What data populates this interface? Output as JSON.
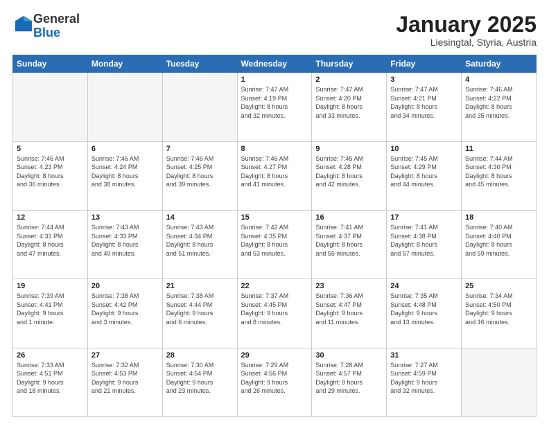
{
  "header": {
    "logo_general": "General",
    "logo_blue": "Blue",
    "month_title": "January 2025",
    "subtitle": "Liesingtal, Styria, Austria"
  },
  "weekdays": [
    "Sunday",
    "Monday",
    "Tuesday",
    "Wednesday",
    "Thursday",
    "Friday",
    "Saturday"
  ],
  "weeks": [
    [
      {
        "day": "",
        "info": ""
      },
      {
        "day": "",
        "info": ""
      },
      {
        "day": "",
        "info": ""
      },
      {
        "day": "1",
        "info": "Sunrise: 7:47 AM\nSunset: 4:19 PM\nDaylight: 8 hours\nand 32 minutes."
      },
      {
        "day": "2",
        "info": "Sunrise: 7:47 AM\nSunset: 4:20 PM\nDaylight: 8 hours\nand 33 minutes."
      },
      {
        "day": "3",
        "info": "Sunrise: 7:47 AM\nSunset: 4:21 PM\nDaylight: 8 hours\nand 34 minutes."
      },
      {
        "day": "4",
        "info": "Sunrise: 7:46 AM\nSunset: 4:22 PM\nDaylight: 8 hours\nand 35 minutes."
      }
    ],
    [
      {
        "day": "5",
        "info": "Sunrise: 7:46 AM\nSunset: 4:23 PM\nDaylight: 8 hours\nand 36 minutes."
      },
      {
        "day": "6",
        "info": "Sunrise: 7:46 AM\nSunset: 4:24 PM\nDaylight: 8 hours\nand 38 minutes."
      },
      {
        "day": "7",
        "info": "Sunrise: 7:46 AM\nSunset: 4:25 PM\nDaylight: 8 hours\nand 39 minutes."
      },
      {
        "day": "8",
        "info": "Sunrise: 7:46 AM\nSunset: 4:27 PM\nDaylight: 8 hours\nand 41 minutes."
      },
      {
        "day": "9",
        "info": "Sunrise: 7:45 AM\nSunset: 4:28 PM\nDaylight: 8 hours\nand 42 minutes."
      },
      {
        "day": "10",
        "info": "Sunrise: 7:45 AM\nSunset: 4:29 PM\nDaylight: 8 hours\nand 44 minutes."
      },
      {
        "day": "11",
        "info": "Sunrise: 7:44 AM\nSunset: 4:30 PM\nDaylight: 8 hours\nand 45 minutes."
      }
    ],
    [
      {
        "day": "12",
        "info": "Sunrise: 7:44 AM\nSunset: 4:31 PM\nDaylight: 8 hours\nand 47 minutes."
      },
      {
        "day": "13",
        "info": "Sunrise: 7:43 AM\nSunset: 4:33 PM\nDaylight: 8 hours\nand 49 minutes."
      },
      {
        "day": "14",
        "info": "Sunrise: 7:43 AM\nSunset: 4:34 PM\nDaylight: 8 hours\nand 51 minutes."
      },
      {
        "day": "15",
        "info": "Sunrise: 7:42 AM\nSunset: 4:35 PM\nDaylight: 8 hours\nand 53 minutes."
      },
      {
        "day": "16",
        "info": "Sunrise: 7:41 AM\nSunset: 4:37 PM\nDaylight: 8 hours\nand 55 minutes."
      },
      {
        "day": "17",
        "info": "Sunrise: 7:41 AM\nSunset: 4:38 PM\nDaylight: 8 hours\nand 57 minutes."
      },
      {
        "day": "18",
        "info": "Sunrise: 7:40 AM\nSunset: 4:40 PM\nDaylight: 8 hours\nand 59 minutes."
      }
    ],
    [
      {
        "day": "19",
        "info": "Sunrise: 7:39 AM\nSunset: 4:41 PM\nDaylight: 9 hours\nand 1 minute."
      },
      {
        "day": "20",
        "info": "Sunrise: 7:38 AM\nSunset: 4:42 PM\nDaylight: 9 hours\nand 3 minutes."
      },
      {
        "day": "21",
        "info": "Sunrise: 7:38 AM\nSunset: 4:44 PM\nDaylight: 9 hours\nand 6 minutes."
      },
      {
        "day": "22",
        "info": "Sunrise: 7:37 AM\nSunset: 4:45 PM\nDaylight: 9 hours\nand 8 minutes."
      },
      {
        "day": "23",
        "info": "Sunrise: 7:36 AM\nSunset: 4:47 PM\nDaylight: 9 hours\nand 11 minutes."
      },
      {
        "day": "24",
        "info": "Sunrise: 7:35 AM\nSunset: 4:48 PM\nDaylight: 9 hours\nand 13 minutes."
      },
      {
        "day": "25",
        "info": "Sunrise: 7:34 AM\nSunset: 4:50 PM\nDaylight: 9 hours\nand 16 minutes."
      }
    ],
    [
      {
        "day": "26",
        "info": "Sunrise: 7:33 AM\nSunset: 4:51 PM\nDaylight: 9 hours\nand 18 minutes."
      },
      {
        "day": "27",
        "info": "Sunrise: 7:32 AM\nSunset: 4:53 PM\nDaylight: 9 hours\nand 21 minutes."
      },
      {
        "day": "28",
        "info": "Sunrise: 7:30 AM\nSunset: 4:54 PM\nDaylight: 9 hours\nand 23 minutes."
      },
      {
        "day": "29",
        "info": "Sunrise: 7:29 AM\nSunset: 4:56 PM\nDaylight: 9 hours\nand 26 minutes."
      },
      {
        "day": "30",
        "info": "Sunrise: 7:28 AM\nSunset: 4:57 PM\nDaylight: 9 hours\nand 29 minutes."
      },
      {
        "day": "31",
        "info": "Sunrise: 7:27 AM\nSunset: 4:59 PM\nDaylight: 9 hours\nand 32 minutes."
      },
      {
        "day": "",
        "info": ""
      }
    ]
  ]
}
